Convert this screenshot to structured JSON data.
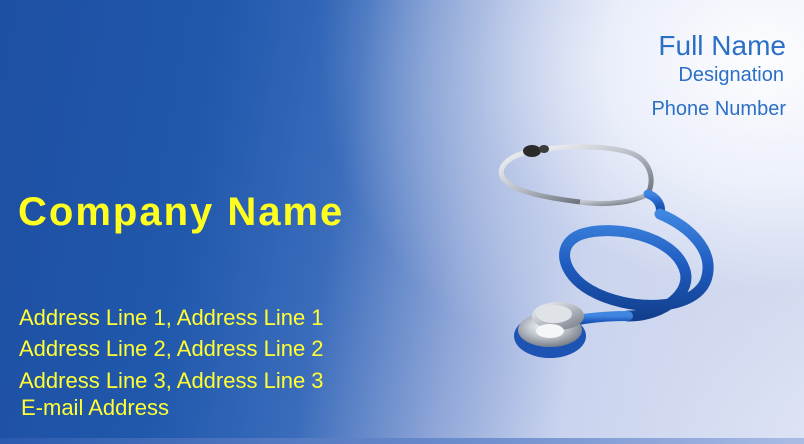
{
  "person": {
    "full_name": "Full Name",
    "designation": "Designation",
    "phone": "Phone Number"
  },
  "company": {
    "name": "Company Name"
  },
  "address": {
    "line1": "Address Line 1,  Address Line 1",
    "line2": "Address Line 2,  Address Line 2",
    "line3": "Address Line 3,  Address Line 3",
    "email": "E-mail Address"
  },
  "colors": {
    "accent_yellow": "#ffff1f",
    "name_blue": "#2c6fc6",
    "background_blue": "#1e4fa2",
    "tube_blue": "#1f5cc0"
  },
  "image": {
    "icon": "stethoscope-icon"
  }
}
